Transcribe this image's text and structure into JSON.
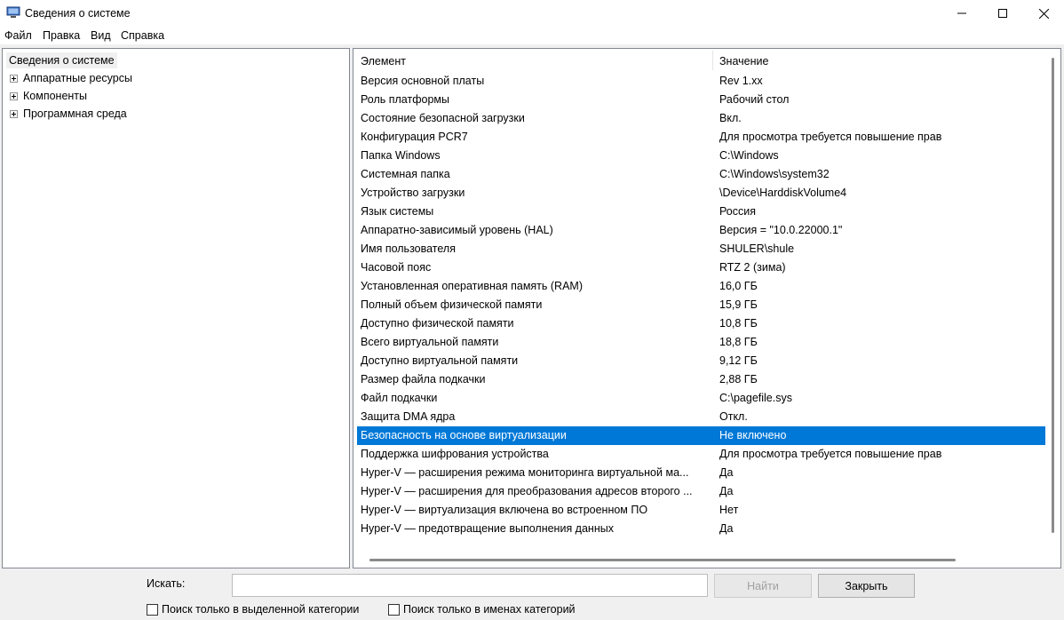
{
  "window": {
    "title": "Сведения о системе"
  },
  "menu": [
    "Файл",
    "Правка",
    "Вид",
    "Справка"
  ],
  "tree": {
    "root": "Сведения о системе",
    "children": [
      "Аппаратные ресурсы",
      "Компоненты",
      "Программная среда"
    ]
  },
  "list": {
    "headers": {
      "item": "Элемент",
      "value": "Значение"
    },
    "rows": [
      {
        "item": "Версия основной платы",
        "value": "Rev 1.xx"
      },
      {
        "item": "Роль платформы",
        "value": "Рабочий стол"
      },
      {
        "item": "Состояние безопасной загрузки",
        "value": "Вкл."
      },
      {
        "item": "Конфигурация PCR7",
        "value": "Для просмотра требуется повышение прав"
      },
      {
        "item": "Папка Windows",
        "value": "C:\\Windows"
      },
      {
        "item": "Системная папка",
        "value": "C:\\Windows\\system32"
      },
      {
        "item": "Устройство загрузки",
        "value": "\\Device\\HarddiskVolume4"
      },
      {
        "item": "Язык системы",
        "value": "Россия"
      },
      {
        "item": "Аппаратно-зависимый уровень (HAL)",
        "value": "Версия = \"10.0.22000.1\""
      },
      {
        "item": "Имя пользователя",
        "value": "SHULER\\shule"
      },
      {
        "item": "Часовой пояс",
        "value": "RTZ 2 (зима)"
      },
      {
        "item": "Установленная оперативная память (RAM)",
        "value": "16,0 ГБ"
      },
      {
        "item": "Полный объем физической памяти",
        "value": "15,9 ГБ"
      },
      {
        "item": "Доступно физической памяти",
        "value": "10,8 ГБ"
      },
      {
        "item": "Всего виртуальной памяти",
        "value": "18,8 ГБ"
      },
      {
        "item": "Доступно виртуальной памяти",
        "value": "9,12 ГБ"
      },
      {
        "item": "Размер файла подкачки",
        "value": "2,88 ГБ"
      },
      {
        "item": "Файл подкачки",
        "value": "C:\\pagefile.sys"
      },
      {
        "item": "Защита DMA ядра",
        "value": "Откл."
      },
      {
        "item": "Безопасность на основе виртуализации",
        "value": "Не включено",
        "selected": true
      },
      {
        "item": "Поддержка шифрования устройства",
        "value": "Для просмотра требуется повышение прав"
      },
      {
        "item": "Hyper-V — расширения режима мониторинга виртуальной ма...",
        "value": "Да"
      },
      {
        "item": "Hyper-V — расширения для преобразования адресов второго ...",
        "value": "Да"
      },
      {
        "item": "Hyper-V — виртуализация включена во встроенном ПО",
        "value": "Нет"
      },
      {
        "item": "Hyper-V — предотвращение выполнения данных",
        "value": "Да"
      }
    ]
  },
  "search": {
    "label": "Искать:",
    "value": "",
    "find_button": "Найти",
    "close_button": "Закрыть",
    "check_selected_category": "Поиск только в выделенной категории",
    "check_category_names": "Поиск только в именах категорий"
  },
  "colors": {
    "selection": "#0078d7"
  }
}
